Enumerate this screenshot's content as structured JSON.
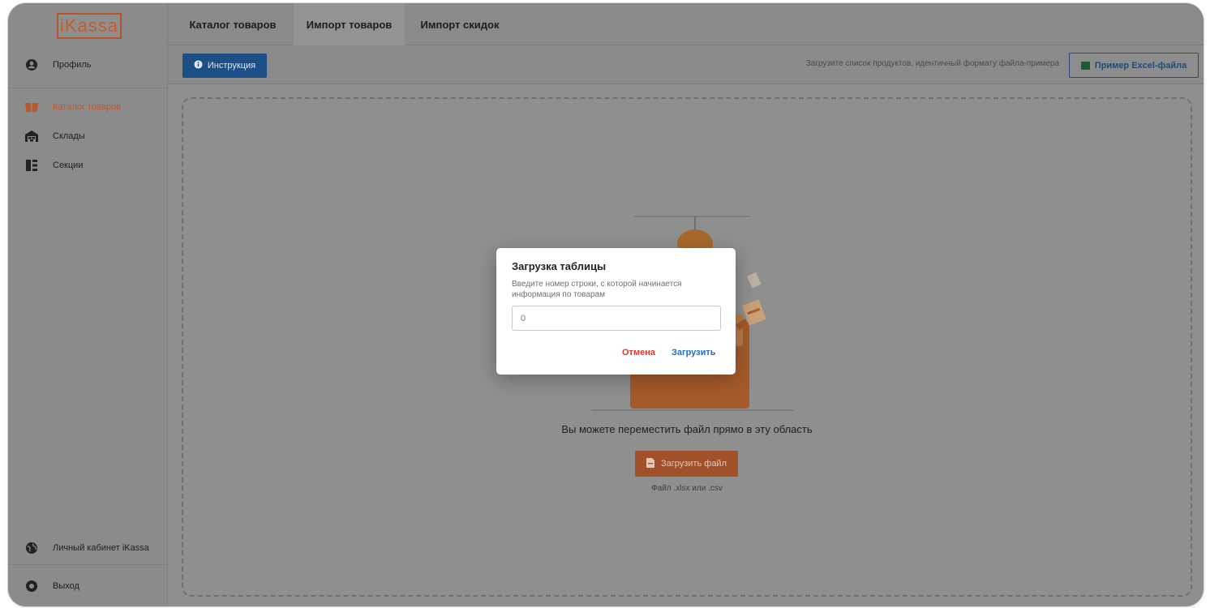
{
  "sidebar": {
    "logo": "iKassa",
    "items": [
      {
        "label": "Профиль",
        "icon": "user-circle-icon"
      },
      {
        "label": "Каталог товаров",
        "icon": "boxes-icon",
        "active": true
      },
      {
        "label": "Склады",
        "icon": "warehouse-icon"
      },
      {
        "label": "Секции",
        "icon": "sections-icon"
      }
    ],
    "bottom_items": [
      {
        "label": "Личный кабинет iKassa",
        "icon": "globe-icon"
      },
      {
        "label": "Выход",
        "icon": "logout-icon"
      }
    ]
  },
  "tabs": [
    {
      "label": "Каталог товаров"
    },
    {
      "label": "Импорт товаров",
      "active": true
    },
    {
      "label": "Импорт скидок"
    }
  ],
  "toolbar": {
    "instruction_label": "Инструкция",
    "hint": "Загрузите список продуктов, идентичный формату файла-примера",
    "excel_label": "Пример Excel-файла"
  },
  "dropzone": {
    "text": "Вы можете переместить файл прямо в эту область",
    "upload_label": "Загрузить файл",
    "file_note": "Файл .xlsx или .csv"
  },
  "modal": {
    "title": "Загрузка таблицы",
    "description": "Введите номер строки, с которой начинается информация по товарам",
    "input_value": "0",
    "cancel_label": "Отмена",
    "submit_label": "Загрузить"
  },
  "colors": {
    "accent": "#c2572a",
    "primary": "#1d6fd1",
    "danger": "#d9382b"
  }
}
